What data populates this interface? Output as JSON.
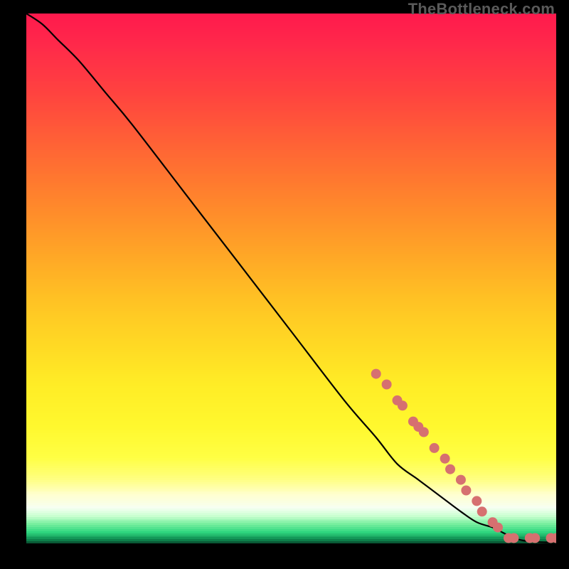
{
  "watermark": "TheBottleneck.com",
  "colors": {
    "black": "#000000",
    "line": "#000000",
    "marker": "#d67070"
  },
  "chart_data": {
    "type": "line",
    "title": "",
    "xlabel": "",
    "ylabel": "",
    "xlim": [
      0,
      100
    ],
    "ylim": [
      0,
      100
    ],
    "curve": {
      "name": "bottleneck-curve",
      "x": [
        0,
        3,
        6,
        10,
        15,
        20,
        30,
        40,
        50,
        60,
        66,
        70,
        74,
        78,
        82,
        85,
        88,
        90,
        92,
        94,
        96,
        98,
        100
      ],
      "y": [
        100,
        98,
        95,
        91,
        85,
        79,
        66,
        53,
        40,
        27,
        20,
        15,
        12,
        9,
        6,
        4,
        3,
        2,
        1,
        0.5,
        0.3,
        0.2,
        0.2
      ]
    },
    "markers": {
      "name": "highlighted-points",
      "color": "#d67070",
      "points": [
        {
          "x": 66,
          "y": 32
        },
        {
          "x": 68,
          "y": 30
        },
        {
          "x": 70,
          "y": 27
        },
        {
          "x": 71,
          "y": 26
        },
        {
          "x": 73,
          "y": 23
        },
        {
          "x": 74,
          "y": 22
        },
        {
          "x": 75,
          "y": 21
        },
        {
          "x": 77,
          "y": 18
        },
        {
          "x": 79,
          "y": 16
        },
        {
          "x": 80,
          "y": 14
        },
        {
          "x": 82,
          "y": 12
        },
        {
          "x": 83,
          "y": 10
        },
        {
          "x": 85,
          "y": 8
        },
        {
          "x": 86,
          "y": 6
        },
        {
          "x": 88,
          "y": 4
        },
        {
          "x": 89,
          "y": 3
        },
        {
          "x": 91,
          "y": 1
        },
        {
          "x": 92,
          "y": 1
        },
        {
          "x": 95,
          "y": 1
        },
        {
          "x": 96,
          "y": 1
        },
        {
          "x": 99,
          "y": 1
        },
        {
          "x": 100,
          "y": 1
        }
      ]
    },
    "background_gradient": {
      "description": "vertical heat gradient red→orange→yellow→pale→green with black frame",
      "stops": [
        {
          "pos": 0.0,
          "color": "#ff1a4d"
        },
        {
          "pos": 0.06,
          "color": "#ff2a4a"
        },
        {
          "pos": 0.14,
          "color": "#ff4040"
        },
        {
          "pos": 0.22,
          "color": "#ff5a38"
        },
        {
          "pos": 0.3,
          "color": "#ff7430"
        },
        {
          "pos": 0.38,
          "color": "#ff8e2a"
        },
        {
          "pos": 0.46,
          "color": "#ffa826"
        },
        {
          "pos": 0.54,
          "color": "#ffc224"
        },
        {
          "pos": 0.62,
          "color": "#ffd824"
        },
        {
          "pos": 0.7,
          "color": "#ffec26"
        },
        {
          "pos": 0.78,
          "color": "#fff82e"
        },
        {
          "pos": 0.84,
          "color": "#ffff44"
        },
        {
          "pos": 0.88,
          "color": "#ffff80"
        },
        {
          "pos": 0.91,
          "color": "#ffffd0"
        },
        {
          "pos": 0.935,
          "color": "#f6fff2"
        },
        {
          "pos": 0.95,
          "color": "#c8ffd0"
        },
        {
          "pos": 0.965,
          "color": "#7aefa0"
        },
        {
          "pos": 0.98,
          "color": "#30d880"
        },
        {
          "pos": 0.995,
          "color": "#0e8a50"
        },
        {
          "pos": 1.0,
          "color": "#0a5a36"
        }
      ]
    }
  }
}
